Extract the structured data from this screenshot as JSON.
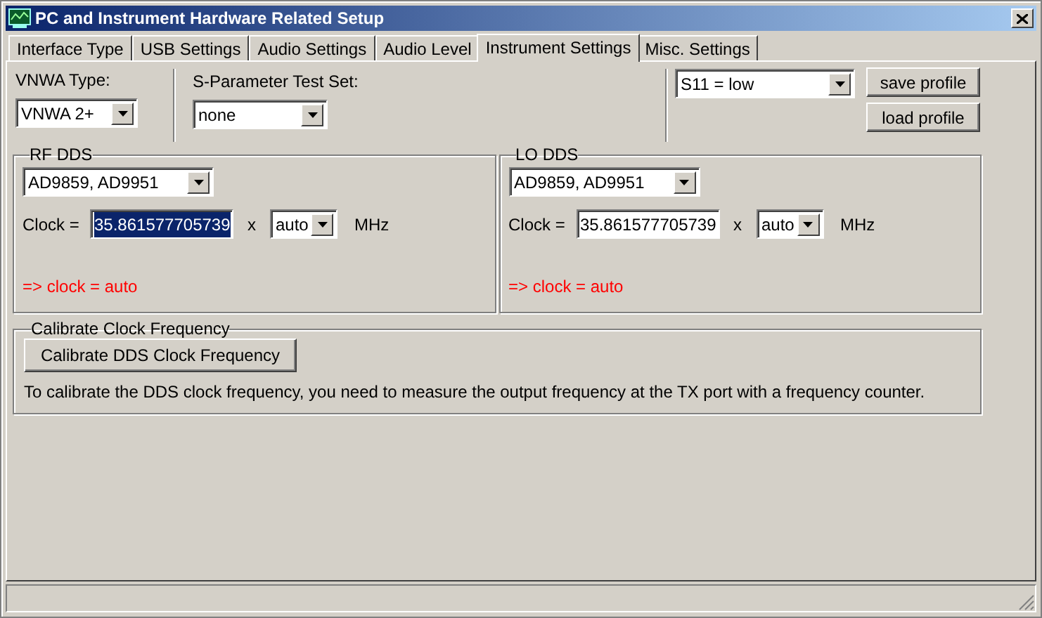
{
  "window": {
    "title": "PC and Instrument Hardware Related Setup"
  },
  "tabs": [
    {
      "label": "Interface Type",
      "selected": false
    },
    {
      "label": "USB Settings",
      "selected": false
    },
    {
      "label": "Audio Settings",
      "selected": false
    },
    {
      "label": "Audio Level",
      "selected": false
    },
    {
      "label": "Instrument Settings",
      "selected": true
    },
    {
      "label": "Misc. Settings",
      "selected": false
    }
  ],
  "vnwa_type": {
    "label": "VNWA Type:",
    "value": "VNWA 2+"
  },
  "test_set": {
    "label": "S-Parameter Test Set:",
    "value": "none"
  },
  "profile": {
    "value": "S11 = low",
    "buttons": [
      "save profile",
      "load profile"
    ]
  },
  "dds_groups": [
    {
      "title": "RF DDS",
      "chip": "AD9859, AD9951",
      "clock_label": "Clock =",
      "clock_value": "35.861577705739",
      "text_selected": true,
      "multiplier_label": "x",
      "multiplier": "auto",
      "unit": "MHz",
      "status": "=> clock = auto"
    },
    {
      "title": "LO DDS",
      "chip": "AD9859, AD9951",
      "clock_label": "Clock =",
      "clock_value": "35.861577705739",
      "text_selected": false,
      "multiplier_label": "x",
      "multiplier": "auto",
      "unit": "MHz",
      "status": "=> clock = auto"
    }
  ],
  "calibrate": {
    "title": "Calibrate Clock Frequency",
    "button": "Calibrate DDS Clock Frequency",
    "note": "To calibrate the DDS clock frequency, you need to measure the output frequency at the TX port with a frequency counter."
  }
}
